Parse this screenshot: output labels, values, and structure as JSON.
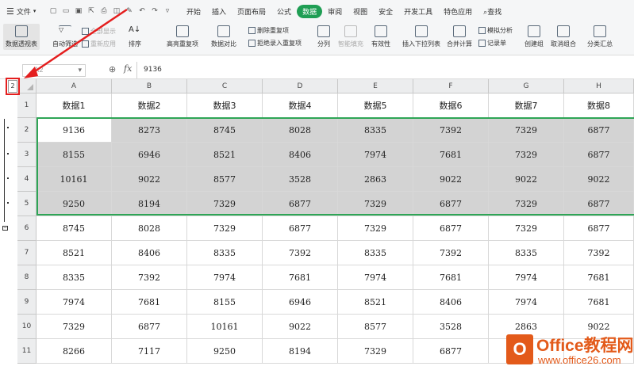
{
  "menubar": {
    "file_label": "文件",
    "tabs": [
      "开始",
      "插入",
      "页面布局",
      "公式",
      "数据",
      "审阅",
      "视图",
      "安全",
      "开发工具",
      "特色应用",
      "查找"
    ],
    "active_tab": "数据"
  },
  "ribbon": {
    "pivot_table": "数据透视表",
    "auto_filter": "自动筛选",
    "show_all": "全部显示",
    "reapply": "重新应用",
    "sort": "排序",
    "highlight_duplicates": "高亮重复项",
    "data_compare": "数据对比",
    "remove_duplicates": "删除重复项",
    "reject_duplicates": "拒绝录入重复项",
    "split": "分列",
    "smart_fill": "智能填充",
    "validity": "有效性",
    "insert_dropdown": "插入下拉列表",
    "consolidate": "合并计算",
    "simulation": "模拟分析",
    "record_form": "记录单",
    "create_group": "创建组",
    "ungroup": "取消组合",
    "subtotal": "分类汇总"
  },
  "formula_bar": {
    "name_box": "A2",
    "fx": "fx",
    "value": "9136"
  },
  "outline_level": "2",
  "columns": [
    "A",
    "B",
    "C",
    "D",
    "E",
    "F",
    "G",
    "H"
  ],
  "rows": [
    {
      "num": "1",
      "cells": [
        "数据1",
        "数据2",
        "数据3",
        "数据4",
        "数据5",
        "数据6",
        "数据7",
        "数据8"
      ]
    },
    {
      "num": "2",
      "cells": [
        "9136",
        "8273",
        "8745",
        "8028",
        "8335",
        "7392",
        "7329",
        "6877"
      ]
    },
    {
      "num": "3",
      "cells": [
        "8155",
        "6946",
        "8521",
        "8406",
        "7974",
        "7681",
        "7329",
        "6877"
      ]
    },
    {
      "num": "4",
      "cells": [
        "10161",
        "9022",
        "8577",
        "3528",
        "2863",
        "9022",
        "9022",
        "9022"
      ]
    },
    {
      "num": "5",
      "cells": [
        "9250",
        "8194",
        "7329",
        "6877",
        "7329",
        "6877",
        "7329",
        "6877"
      ]
    },
    {
      "num": "6",
      "cells": [
        "8745",
        "8028",
        "7329",
        "6877",
        "7329",
        "6877",
        "7329",
        "6877"
      ]
    },
    {
      "num": "7",
      "cells": [
        "8521",
        "8406",
        "8335",
        "7392",
        "8335",
        "7392",
        "8335",
        "7392"
      ]
    },
    {
      "num": "8",
      "cells": [
        "8335",
        "7392",
        "7974",
        "7681",
        "7974",
        "7681",
        "7974",
        "7681"
      ]
    },
    {
      "num": "9",
      "cells": [
        "7974",
        "7681",
        "8155",
        "6946",
        "8521",
        "8406",
        "7974",
        "7681"
      ]
    },
    {
      "num": "10",
      "cells": [
        "7329",
        "6877",
        "10161",
        "9022",
        "8577",
        "3528",
        "2863",
        "9022"
      ]
    },
    {
      "num": "11",
      "cells": [
        "8266",
        "7117",
        "9250",
        "8194",
        "7329",
        "6877",
        "",
        ""
      ]
    }
  ],
  "watermark": {
    "logo_letter": "O",
    "title": "Office教程网",
    "url": "www.office26.com"
  },
  "colors": {
    "accent_green": "#1f9e54",
    "selection_border": "#2ea556",
    "annotation_red": "#e41e1e",
    "watermark_orange": "#e35a1a"
  }
}
